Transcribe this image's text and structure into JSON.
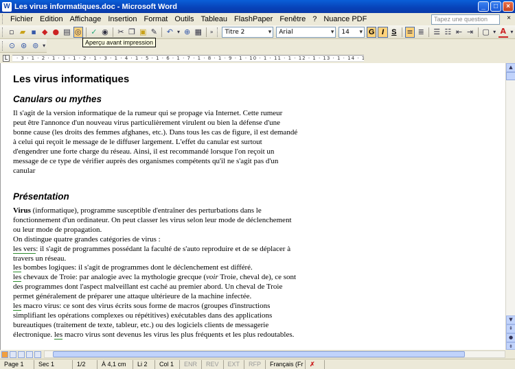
{
  "window": {
    "title": "Les virus informatiques.doc - Microsoft Word",
    "app_icon": "W"
  },
  "menu": {
    "items": [
      "Fichier",
      "Edition",
      "Affichage",
      "Insertion",
      "Format",
      "Outils",
      "Tableau",
      "FlashPaper",
      "Fenêtre",
      "?",
      "Nuance PDF"
    ],
    "help_placeholder": "Tapez une question"
  },
  "toolbar": {
    "style_value": "Titre 2",
    "font_value": "Arial",
    "size_value": "14",
    "bold_label": "G",
    "italic_label": "I",
    "underline_label": "S",
    "tooltip": "Aperçu avant impression"
  },
  "ruler": {
    "marks": "· 3 · 1 · 2 · 1 · 1 · 1 · 2 · 1 · 3 · 1 · 4 · 1 · 5 · 1 · 6 · 1 · 7 · 1 · 8 · 1 · 9 · 1 · 10 · 1 · 11 · 1 · 12 · 1 · 13 · 1 · 14 · 1 · 15 · 1 · 16 · 1 · 17 · 1 · 18 ·"
  },
  "document": {
    "title": "Les virus informatiques",
    "h2_canulars": "Canulars ou mythes",
    "canulars_lines": [
      "Il s'agit de la version informatique de la rumeur qui se propage via Internet. Cette rumeur",
      "peut être l'annonce d'un nouveau virus particulièrement virulent ou bien la défense d'une",
      "bonne cause (les droits des femmes afghanes, etc.). Dans tous les cas de figure, il est demandé",
      "à celui qui reçoit le message de le diffuser largement. L'effet du canular est surtout",
      "d'engendrer une forte charge du réseau. Ainsi, il est recommandé lorsque l'on reçoit un",
      "message de ce type de vérifier auprès des organismes compétents qu'il ne s'agit pas d'un",
      "canular"
    ],
    "h2_presentation": "Présentation",
    "pres_bold": "Virus",
    "pres_line1_rest": " (informatique), programme susceptible d'entraîner des perturbations dans le",
    "pres_lines": [
      "fonctionnement d'un ordinateur. On peut classer les virus selon leur mode de déclenchement",
      "ou leur mode de propagation.",
      "On distingue quatre grandes catégories de virus :"
    ],
    "vers_ul": "les vers",
    "vers_rest": ": il s'agit de programmes possédant la faculté de s'auto reproduire et de se déplacer à",
    "vers_line2": "travers un réseau.",
    "bombes_ul": "les",
    "bombes_rest": " bombes logiques: il s'agit de programmes dont le déclenchement est différé.",
    "chevaux_ul": "les",
    "chevaux_a": " chevaux de Troie: par analogie avec la mythologie grecque (",
    "chevaux_voir": "voir",
    "chevaux_b": " Troie, cheval de), ce sont",
    "chevaux_lines": [
      "des programmes dont l'aspect malveillant est caché au premier abord. Un cheval de Troie",
      "permet généralement de préparer une attaque ultérieure de la machine infectée."
    ],
    "macro_ul": "les",
    "macro_rest": " macro virus: ce sont des virus écrits sous forme de macros (groupes d'instructions",
    "macro_lines": [
      "simplifiant les opérations complexes ou répétitives) exécutables dans des applications",
      "bureautiques (traitement de texte, tableur, etc.) ou des logiciels clients de messagerie"
    ],
    "macro_last_a": "électronique. ",
    "macro_last_ul": "les",
    "macro_last_b": " macro virus sont devenus les virus les plus fréquents et les plus redoutables."
  },
  "status": {
    "page": "Page 1",
    "sec": "Sec 1",
    "pages": "1/2",
    "at": "À 4,1 cm",
    "line": "Li 2",
    "col": "Col 1",
    "rec": "ENR",
    "rev": "REV",
    "ext": "EXT",
    "rfp": "RFP",
    "lang": "Français (Fr"
  }
}
